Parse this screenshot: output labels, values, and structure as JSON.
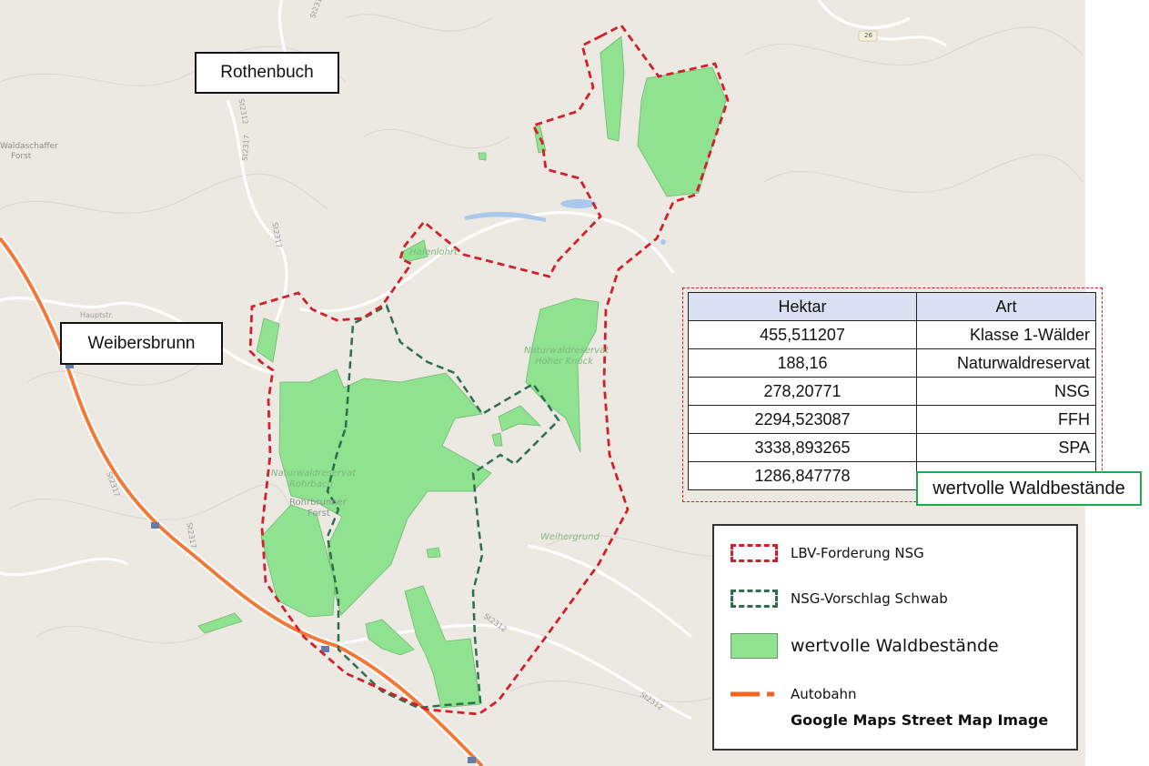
{
  "map": {
    "place_labels": [
      "Rothenbuch",
      "Weibersbrunn"
    ],
    "map_text": {
      "waldaschaff": "Waldaschaffer",
      "forst": "Forst",
      "hafenlohr": "Hafenlohrt",
      "nwr_hoher": "Naturwaldreservat",
      "nwr_hoher2": "Hoher Knuck",
      "nwr_rohr": "Naturwaldreservat",
      "nwr_rohr2": "Rohrbach",
      "rohr_forst": "Rohrbrunner",
      "rohr_forst2": "Forst",
      "weihergrund": "Weihergrund",
      "haupt": "Hauptstr.",
      "road_26": "26"
    },
    "road_labels": [
      "St2317",
      "St2312",
      "St2317",
      "St2317",
      "St2317",
      "St2312",
      "St2312",
      "St2317"
    ]
  },
  "table": {
    "headers": [
      "Hektar",
      "Art"
    ],
    "rows": [
      [
        "455,511207",
        "Klasse 1-Wälder"
      ],
      [
        "188,16",
        "Naturwaldreservat"
      ],
      [
        "278,20771",
        "NSG"
      ],
      [
        "2294,523087",
        "FFH"
      ],
      [
        "3338,893265",
        "SPA"
      ],
      [
        "1286,847778",
        "wertvolle Waldbestände"
      ]
    ]
  },
  "legend": {
    "items": [
      {
        "label": "LBV-Forderung NSG",
        "color": "#d0202a"
      },
      {
        "label": "NSG-Vorschlag Schwab",
        "color": "#2e6e4e"
      },
      {
        "label": "wertvolle Waldbestände",
        "color": "#8fe28f"
      },
      {
        "label": "Autobahn",
        "color": "#f26522"
      }
    ],
    "source": "Google Maps Street Map Image"
  }
}
